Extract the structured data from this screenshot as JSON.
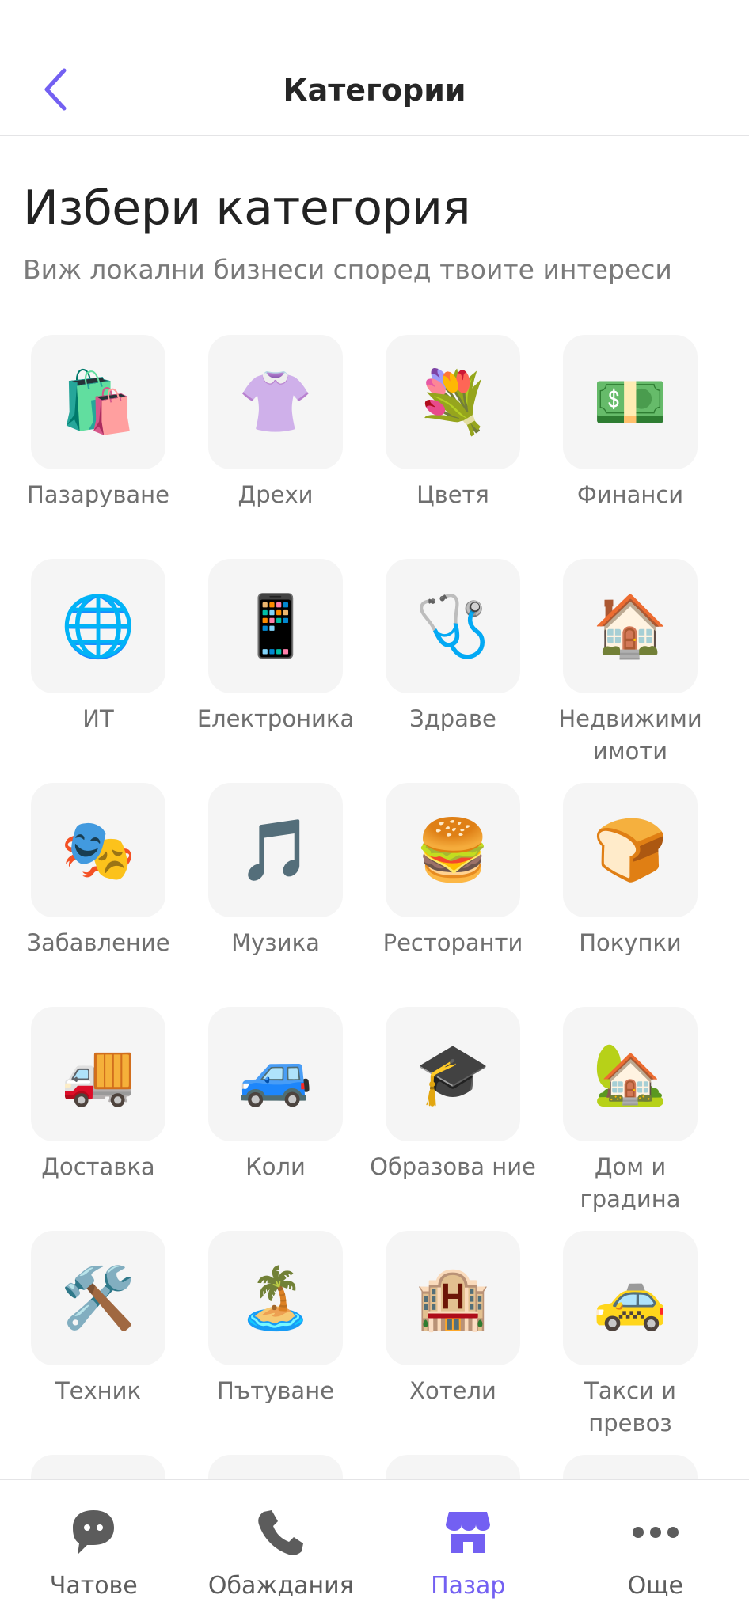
{
  "header": {
    "title": "Категории"
  },
  "heading": {
    "title": "Избери категория",
    "subtitle": "Виж локални бизнеси според твоите интереси"
  },
  "categories": [
    {
      "label": "Пазаруване",
      "icon": "🛍️",
      "icon_name": "shopping-bags-icon"
    },
    {
      "label": "Дрехи",
      "icon": "👚",
      "icon_name": "blouse-icon"
    },
    {
      "label": "Цветя",
      "icon": "💐",
      "icon_name": "bouquet-icon"
    },
    {
      "label": "Финанси",
      "icon": "💵",
      "icon_name": "money-icon"
    },
    {
      "label": "ИТ",
      "icon": "🌐",
      "icon_name": "globe-icon"
    },
    {
      "label": "Електроника",
      "icon": "📱",
      "icon_name": "phone-icon"
    },
    {
      "label": "Здраве",
      "icon": "🩺",
      "icon_name": "stethoscope-icon"
    },
    {
      "label": "Недвижими имоти",
      "icon": "🏠",
      "icon_name": "house-icon"
    },
    {
      "label": "Забавление",
      "icon": "🎭",
      "icon_name": "theater-masks-icon"
    },
    {
      "label": "Музика",
      "icon": "🎵",
      "icon_name": "music-note-icon"
    },
    {
      "label": "Ресторанти",
      "icon": "🍔",
      "icon_name": "burger-icon"
    },
    {
      "label": "Покупки",
      "icon": "🍞",
      "icon_name": "bread-icon"
    },
    {
      "label": "Доставка",
      "icon": "🚚",
      "icon_name": "delivery-truck-icon"
    },
    {
      "label": "Коли",
      "icon": "🚙",
      "icon_name": "car-icon"
    },
    {
      "label": "Образова ние",
      "icon": "🎓",
      "icon_name": "graduation-cap-icon"
    },
    {
      "label": "Дом и градина",
      "icon": "🏡",
      "icon_name": "house-garden-icon"
    },
    {
      "label": "Техник",
      "icon": "🛠️",
      "icon_name": "tools-icon"
    },
    {
      "label": "Пътуване",
      "icon": "🏝️",
      "icon_name": "beach-umbrella-icon"
    },
    {
      "label": "Хотели",
      "icon": "🏨",
      "icon_name": "hotel-icon"
    },
    {
      "label": "Такси и превоз",
      "icon": "🚕",
      "icon_name": "taxi-icon"
    }
  ],
  "tabbar": {
    "tabs": [
      {
        "label": "Чатове",
        "icon_name": "chat-bubble-icon",
        "active": false
      },
      {
        "label": "Обаждания",
        "icon_name": "phone-handset-icon",
        "active": false
      },
      {
        "label": "Пазар",
        "icon_name": "storefront-icon",
        "active": true
      },
      {
        "label": "Още",
        "icon_name": "more-dots-icon",
        "active": false
      }
    ]
  },
  "colors": {
    "accent": "#7360f2",
    "icon_gray": "#5c5c5c",
    "tile_bg": "#f5f5f5"
  }
}
